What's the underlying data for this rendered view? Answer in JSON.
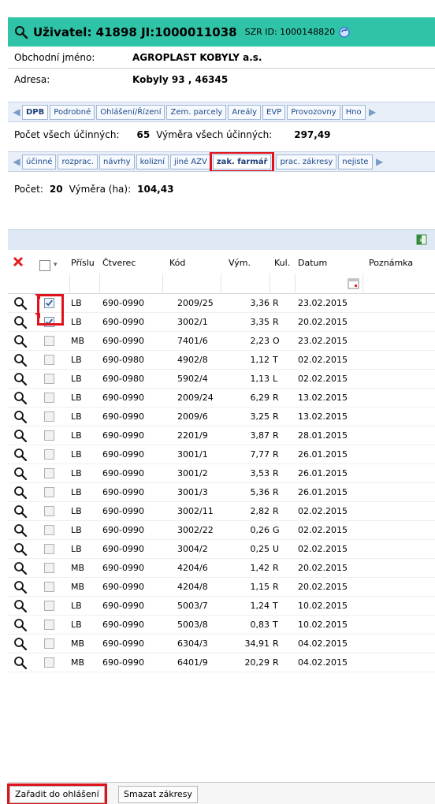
{
  "header": {
    "title": "Uživatel: 41898 JI:1000011038",
    "szr": "SZR ID: 1000148820"
  },
  "info": {
    "name_label": "Obchodní jméno:",
    "name_value": "AGROPLAST KOBYLY a.s.",
    "address_label": "Adresa:",
    "address_value": "Kobyly 93 , 46345"
  },
  "tabs1": [
    "DPB",
    "Podrobné",
    "Ohlášení/Řízení",
    "Zem. parcely",
    "Areály",
    "EVP",
    "Provozovny",
    "Hno"
  ],
  "summary1": {
    "count_label": "Počet všech účinných:",
    "count_value": "65",
    "area_label": "Výměra všech účinných:",
    "area_value": "297,49"
  },
  "tabs2": [
    "účinné",
    "rozprac.",
    "návrhy",
    "kolizní",
    "jiné AZV",
    "zak. farmář",
    "prac. zákresy",
    "nejiste"
  ],
  "summary2": {
    "count_label": "Počet:",
    "count_value": "20",
    "area_label": "Výměra (ha):",
    "area_value": "104,43"
  },
  "columns": [
    "Příslu",
    "Čtverec",
    "Kód",
    "Vým.",
    "Kul.",
    "Datum",
    "Poznámka"
  ],
  "rows": [
    {
      "checked": true,
      "prislu": "LB",
      "ctverec": "690-0990",
      "kod": "2009/25",
      "vym": "3,36",
      "kul": "R",
      "datum": "23.02.2015"
    },
    {
      "checked": true,
      "prislu": "LB",
      "ctverec": "690-0990",
      "kod": "3002/1",
      "vym": "3,35",
      "kul": "R",
      "datum": "20.02.2015"
    },
    {
      "checked": false,
      "prislu": "MB",
      "ctverec": "690-0990",
      "kod": "7401/6",
      "vym": "2,23",
      "kul": "O",
      "datum": "23.02.2015"
    },
    {
      "checked": false,
      "prislu": "LB",
      "ctverec": "690-0980",
      "kod": "4902/8",
      "vym": "1,12",
      "kul": "T",
      "datum": "02.02.2015"
    },
    {
      "checked": false,
      "prislu": "LB",
      "ctverec": "690-0980",
      "kod": "5902/4",
      "vym": "1,13",
      "kul": "L",
      "datum": "02.02.2015"
    },
    {
      "checked": false,
      "prislu": "LB",
      "ctverec": "690-0990",
      "kod": "2009/24",
      "vym": "6,29",
      "kul": "R",
      "datum": "13.02.2015"
    },
    {
      "checked": false,
      "prislu": "LB",
      "ctverec": "690-0990",
      "kod": "2009/6",
      "vym": "3,25",
      "kul": "R",
      "datum": "13.02.2015"
    },
    {
      "checked": false,
      "prislu": "LB",
      "ctverec": "690-0990",
      "kod": "2201/9",
      "vym": "3,87",
      "kul": "R",
      "datum": "28.01.2015"
    },
    {
      "checked": false,
      "prislu": "LB",
      "ctverec": "690-0990",
      "kod": "3001/1",
      "vym": "7,77",
      "kul": "R",
      "datum": "26.01.2015"
    },
    {
      "checked": false,
      "prislu": "LB",
      "ctverec": "690-0990",
      "kod": "3001/2",
      "vym": "3,53",
      "kul": "R",
      "datum": "26.01.2015"
    },
    {
      "checked": false,
      "prislu": "LB",
      "ctverec": "690-0990",
      "kod": "3001/3",
      "vym": "5,36",
      "kul": "R",
      "datum": "26.01.2015"
    },
    {
      "checked": false,
      "prislu": "LB",
      "ctverec": "690-0990",
      "kod": "3002/11",
      "vym": "2,82",
      "kul": "R",
      "datum": "02.02.2015"
    },
    {
      "checked": false,
      "prislu": "LB",
      "ctverec": "690-0990",
      "kod": "3002/22",
      "vym": "0,26",
      "kul": "G",
      "datum": "02.02.2015"
    },
    {
      "checked": false,
      "prislu": "LB",
      "ctverec": "690-0990",
      "kod": "3004/2",
      "vym": "0,25",
      "kul": "U",
      "datum": "02.02.2015"
    },
    {
      "checked": false,
      "prislu": "MB",
      "ctverec": "690-0990",
      "kod": "4204/6",
      "vym": "1,42",
      "kul": "R",
      "datum": "20.02.2015"
    },
    {
      "checked": false,
      "prislu": "MB",
      "ctverec": "690-0990",
      "kod": "4204/8",
      "vym": "1,15",
      "kul": "R",
      "datum": "20.02.2015"
    },
    {
      "checked": false,
      "prislu": "LB",
      "ctverec": "690-0990",
      "kod": "5003/7",
      "vym": "1,24",
      "kul": "T",
      "datum": "10.02.2015"
    },
    {
      "checked": false,
      "prislu": "LB",
      "ctverec": "690-0990",
      "kod": "5003/8",
      "vym": "0,83",
      "kul": "T",
      "datum": "10.02.2015"
    },
    {
      "checked": false,
      "prislu": "MB",
      "ctverec": "690-0990",
      "kod": "6304/3",
      "vym": "34,91",
      "kul": "R",
      "datum": "04.02.2015"
    },
    {
      "checked": false,
      "prislu": "MB",
      "ctverec": "690-0990",
      "kod": "6401/9",
      "vym": "20,29",
      "kul": "R",
      "datum": "04.02.2015"
    }
  ],
  "buttons": {
    "assign": "Zařadit do ohlášení",
    "delete": "Smazat zákresy"
  },
  "colors": {
    "title_bg": "#2fc3a8",
    "highlight": "#e0121b",
    "tab_text": "#1e4b8a"
  }
}
